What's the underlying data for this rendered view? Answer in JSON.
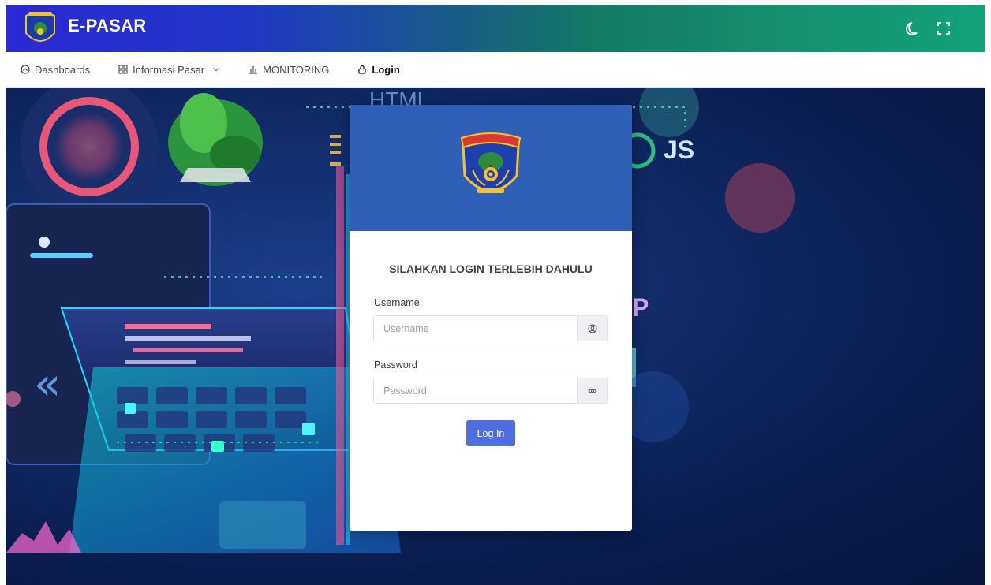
{
  "header": {
    "app_name": "E-PASAR",
    "brand_color_start": "#2a29d6",
    "brand_color_end": "#14a27a"
  },
  "nav": {
    "items": [
      {
        "label": "Dashboards",
        "icon": "dashboard-icon"
      },
      {
        "label": "Informasi Pasar",
        "icon": "grid-icon",
        "dropdown": true
      },
      {
        "label": "MONITORING",
        "icon": "bar-chart-icon"
      },
      {
        "label": "Login",
        "icon": "lock-icon",
        "active": true
      }
    ]
  },
  "login": {
    "title": "SILAHKAN LOGIN TERLEBIH DAHULU",
    "username_label": "Username",
    "username_placeholder": "Username",
    "password_label": "Password",
    "password_placeholder": "Password",
    "submit_label": "Log In"
  },
  "colors": {
    "card_header": "#2f5fb7",
    "button": "#4f6ee0"
  }
}
